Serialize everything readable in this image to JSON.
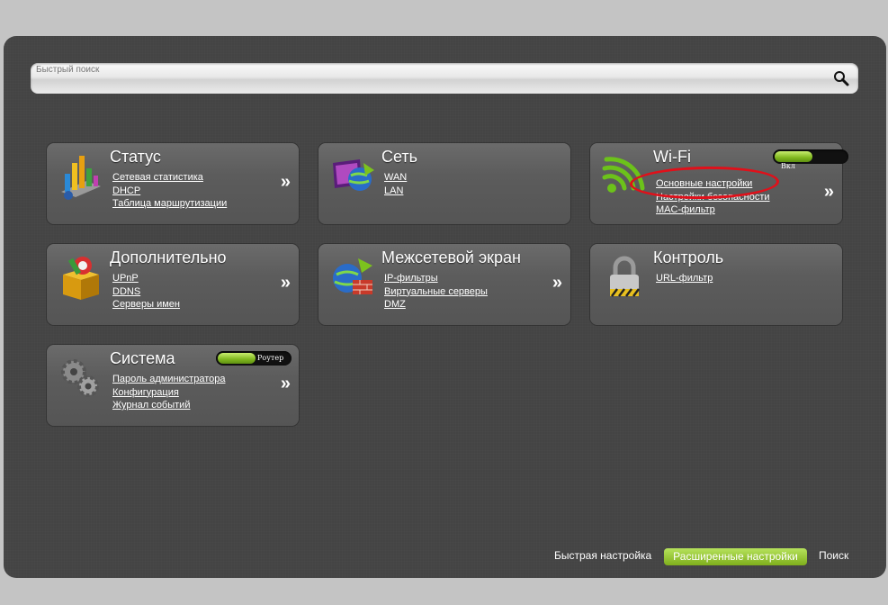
{
  "search": {
    "placeholder": "Быстрый поиск"
  },
  "tiles": {
    "status": {
      "title": "Статус",
      "links": [
        "Сетевая статистика",
        "DHCP",
        "Таблица маршрутизации"
      ],
      "arrow": "»",
      "icon": "bar-chart-icon"
    },
    "network": {
      "title": "Сеть",
      "links": [
        "WAN",
        "LAN"
      ],
      "icon": "globe-monitor-icon"
    },
    "wifi": {
      "title": "Wi-Fi",
      "links": [
        "Основные настройки",
        "Настройки безопасности",
        "MAC-фильтр"
      ],
      "arrow": "»",
      "icon": "wifi-icon",
      "toggle_label": "Вкл",
      "toggle_on": true
    },
    "advanced": {
      "title": "Дополнительно",
      "links": [
        "UPnP",
        "DDNS",
        "Серверы имен"
      ],
      "arrow": "»",
      "icon": "toolbox-icon"
    },
    "firewall": {
      "title": "Межсетевой экран",
      "links": [
        "IP-фильтры",
        "Виртуальные серверы",
        "DMZ"
      ],
      "arrow": "»",
      "icon": "firewall-globe-icon"
    },
    "control": {
      "title": "Контроль",
      "links": [
        "URL-фильтр"
      ],
      "icon": "padlock-icon"
    },
    "system": {
      "title": "Система",
      "links": [
        "Пароль администратора",
        "Конфигурация",
        "Журнал событий"
      ],
      "arrow": "»",
      "icon": "gears-icon",
      "toggle_label": "Роутер",
      "toggle_on": true
    }
  },
  "annotation": {
    "color": "#e0101a",
    "target": "Основные настройки"
  },
  "footer": {
    "quick_setup": "Быстрая настройка",
    "advanced_settings": "Расширенные настройки",
    "search": "Поиск",
    "active": "advanced_settings",
    "accent": "#8cc230"
  }
}
